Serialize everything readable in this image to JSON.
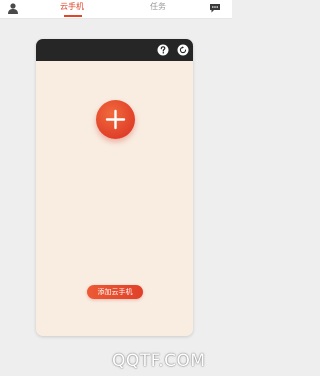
{
  "header": {
    "tabs": [
      {
        "label": "云手机",
        "active": true
      },
      {
        "label": "任务",
        "active": false
      }
    ]
  },
  "card": {
    "add_button_label": "添加云手机"
  },
  "watermark": {
    "text": "QQTF.COM"
  },
  "colors": {
    "accent": "#e0462b",
    "card_background": "#f9ede2",
    "card_header": "#262626",
    "page_background": "#eeeeee"
  },
  "icons": [
    "user-avatar-icon",
    "message-icon",
    "help-icon",
    "refresh-icon",
    "plus-icon"
  ]
}
